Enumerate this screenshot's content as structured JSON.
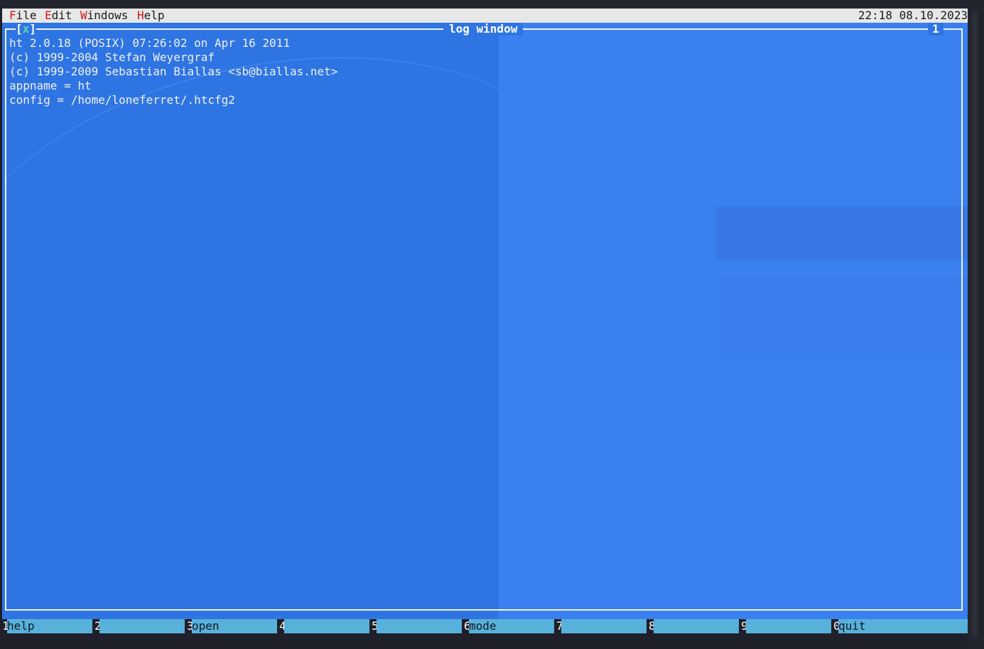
{
  "menubar": {
    "items": [
      {
        "hotkey": "F",
        "rest": "ile"
      },
      {
        "hotkey": "E",
        "rest": "dit"
      },
      {
        "hotkey": "W",
        "rest": "indows"
      },
      {
        "hotkey": "H",
        "rest": "elp"
      }
    ],
    "clock": "22:18 08.10.2023"
  },
  "window": {
    "close_open": "[",
    "close_x": "x",
    "close_close": "]",
    "title": "log window",
    "number": "1"
  },
  "log": {
    "lines": [
      "ht 2.0.18 (POSIX) 07:26:02 on Apr 16 2011",
      "(c) 1999-2004 Stefan Weyergraf",
      "(c) 1999-2009 Sebastian Biallas <sb@biallas.net>",
      "appname = ht",
      "config = /home/loneferret/.htcfg2"
    ]
  },
  "fkeys": [
    {
      "num": "1",
      "label": "help"
    },
    {
      "num": "2",
      "label": ""
    },
    {
      "num": "3",
      "label": "open"
    },
    {
      "num": "4",
      "label": ""
    },
    {
      "num": "5",
      "label": ""
    },
    {
      "num": "6",
      "label": "mode"
    },
    {
      "num": "7",
      "label": ""
    },
    {
      "num": "8",
      "label": ""
    },
    {
      "num": "9",
      "label": ""
    },
    {
      "num": "0",
      "label": "quit"
    }
  ],
  "colors": {
    "desktop": "#2e75e3",
    "menubar": "#e7e7e7",
    "hotkey": "#d01818",
    "fkey_label_bg": "#58b1da"
  }
}
